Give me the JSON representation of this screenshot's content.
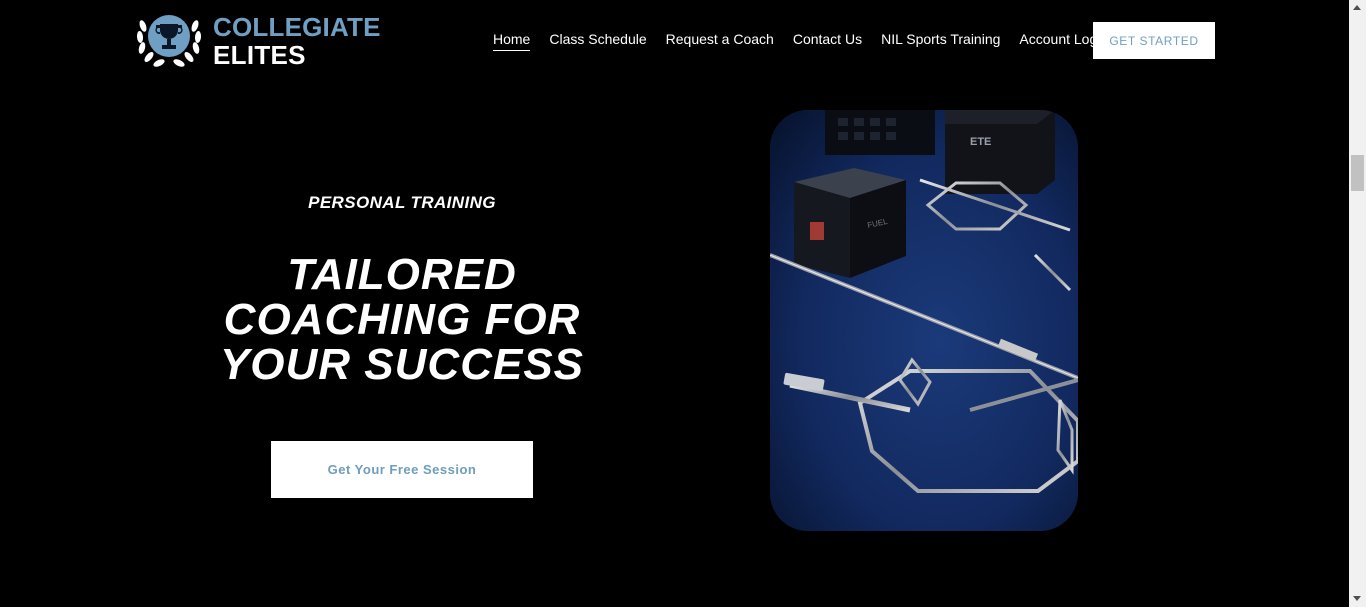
{
  "brand": {
    "name_line1": "COLLEGIATE",
    "name_line2": "ELITES",
    "accent_color": "#6fa0c4",
    "emblem_icon": "trophy-laurel-icon"
  },
  "nav": {
    "items": [
      {
        "label": "Home",
        "active": true
      },
      {
        "label": "Class Schedule"
      },
      {
        "label": "Request a Coach"
      },
      {
        "label": "Contact Us"
      },
      {
        "label": "NIL Sports Training"
      },
      {
        "label": "Account Log In"
      }
    ],
    "cta_label": "GET STARTED"
  },
  "hero": {
    "eyebrow": "PERSONAL TRAINING",
    "headline_line1": "TAILORED",
    "headline_line2": "COACHING FOR",
    "headline_line3": "YOUR SUCCESS",
    "button_label": "Get Your Free Session",
    "image_icon": "gym-equipment-photo"
  }
}
